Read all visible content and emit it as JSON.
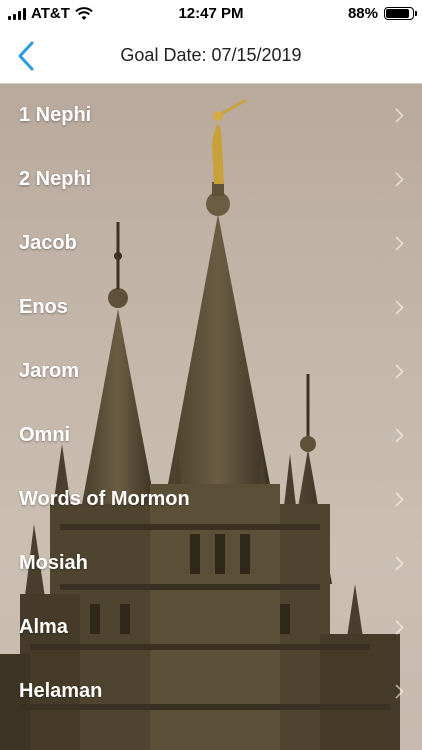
{
  "status_bar": {
    "carrier": "AT&T",
    "time": "12:47 PM",
    "battery_text": "88%",
    "battery_level": 0.88,
    "icons": [
      "signal-icon",
      "wifi-icon",
      "battery-icon"
    ]
  },
  "nav": {
    "back_icon": "chevron-left-icon",
    "title": "Goal Date: 07/15/2019",
    "accent_color": "#2b9be0"
  },
  "books": [
    {
      "label": "1 Nephi"
    },
    {
      "label": "2 Nephi"
    },
    {
      "label": "Jacob"
    },
    {
      "label": "Enos"
    },
    {
      "label": "Jarom"
    },
    {
      "label": "Omni"
    },
    {
      "label": "Words of Mormon"
    },
    {
      "label": "Mosiah"
    },
    {
      "label": "Alma"
    },
    {
      "label": "Helaman"
    }
  ]
}
